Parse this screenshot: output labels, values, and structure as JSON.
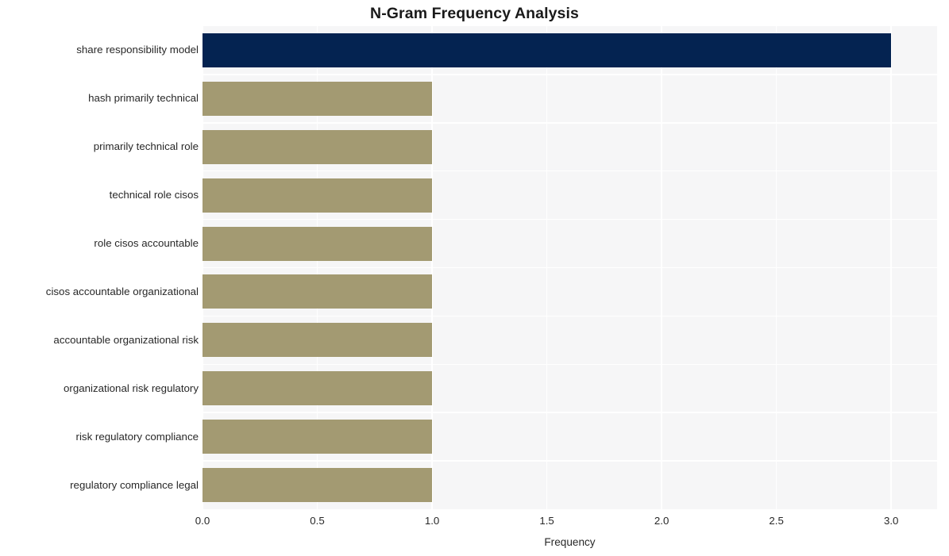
{
  "chart_data": {
    "type": "bar",
    "orientation": "horizontal",
    "title": "N-Gram Frequency Analysis",
    "xlabel": "Frequency",
    "ylabel": "",
    "categories": [
      "share responsibility model",
      "hash primarily technical",
      "primarily technical role",
      "technical role cisos",
      "role cisos accountable",
      "cisos accountable organizational",
      "accountable organizational risk",
      "organizational risk regulatory",
      "risk regulatory compliance",
      "regulatory compliance legal"
    ],
    "values": [
      3,
      1,
      1,
      1,
      1,
      1,
      1,
      1,
      1,
      1
    ],
    "xlim": [
      0.0,
      3.2
    ],
    "xticks": [
      "0.0",
      "0.5",
      "1.0",
      "1.5",
      "2.0",
      "2.5",
      "3.0"
    ],
    "xtick_values": [
      0.0,
      0.5,
      1.0,
      1.5,
      2.0,
      2.5,
      3.0
    ],
    "grid": true,
    "legend": false,
    "bar_colors": [
      "#042351",
      "#a39a72",
      "#a39a72",
      "#a39a72",
      "#a39a72",
      "#a39a72",
      "#a39a72",
      "#a39a72",
      "#a39a72",
      "#a39a72"
    ],
    "colors": {
      "highlight_bar": "#042351",
      "default_bar": "#a39a72",
      "plot_background": "#f6f6f7",
      "figure_background": "#ffffff",
      "gridline": "#ffffff",
      "text": "#282828",
      "title_text": "#1a1a1a"
    }
  }
}
